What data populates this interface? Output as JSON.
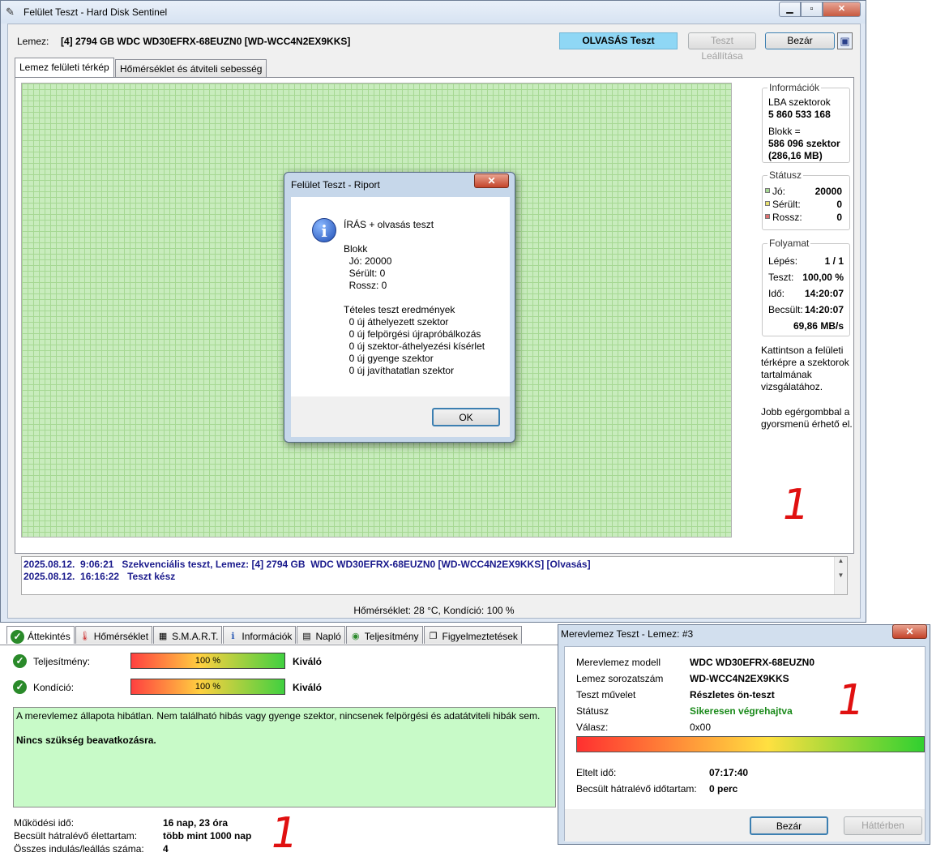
{
  "main_window": {
    "title": "Felület Teszt - Hard Disk Sentinel",
    "disk_label": "Lemez:",
    "disk_value": "[4] 2794 GB  WDC WD30EFRX-68EUZN0 [WD-WCC4N2EX9KKS]",
    "mode_label": "OLVASÁS Teszt",
    "stop_button": "Teszt Leállítása",
    "close_button": "Bezár",
    "tabs": [
      "Lemez felületi térkép",
      "Hőmérséklet és átviteli sebesség"
    ],
    "info": {
      "legend": "Információk",
      "lba_label": "LBA szektorok",
      "lba_value": "5 860 533 168",
      "block_label": "Blokk =",
      "block_value": "586 096 szektor",
      "block_size": "(286,16 MB)"
    },
    "status": {
      "legend": "Státusz",
      "good_label": "Jó:",
      "good_value": "20000",
      "damaged_label": "Sérült:",
      "damaged_value": "0",
      "bad_label": "Rossz:",
      "bad_value": "0",
      "good_color": "#a6d893",
      "damaged_color": "#e8e070",
      "bad_color": "#e07070"
    },
    "progress": {
      "legend": "Folyamat",
      "step_label": "Lépés:",
      "step_value": "1 / 1",
      "test_label": "Teszt:",
      "test_value": "100,00 %",
      "time_label": "Idő:",
      "time_value": "14:20:07",
      "est_label": "Becsült:",
      "est_value": "14:20:07",
      "speed": "69,86 MB/s"
    },
    "hint1": "Kattintson a felületi térképre a szektorok tartalmának vizsgálatához.",
    "hint2": "Jobb egérgombbal a gyorsmenü érhető el.",
    "mark": "1",
    "log": [
      "2025.08.12.  9:06:21   Szekvenciális teszt, Lemez: [4] 2794 GB  WDC WD30EFRX-68EUZN0 [WD-WCC4N2EX9KKS] [Olvasás]",
      "2025.08.12.  16:16:22   Teszt kész"
    ],
    "statusbar": "Hőmérséklet: 28  °C, Kondíció: 100 %"
  },
  "report_dialog": {
    "title": "Felület Teszt - Riport",
    "heading": "ÍRÁS + olvasás teszt",
    "lines": [
      "Blokk",
      "  Jó: 20000",
      "  Sérült: 0",
      "  Rossz: 0",
      "",
      "Tételes teszt eredmények",
      "  0 új áthelyezett szektor",
      "  0 új felpörgési újrapróbálkozás",
      "  0 új szektor-áthelyezési kísérlet",
      "  0 új gyenge szektor",
      "  0 új javíthatatlan szektor"
    ],
    "ok_button": "OK"
  },
  "overview": {
    "tabs": [
      "Áttekintés",
      "Hőmérséklet",
      "S.M.A.R.T.",
      "Információk",
      "Napló",
      "Teljesítmény",
      "Figyelmeztetések"
    ],
    "perf_label": "Teljesítmény:",
    "perf_value": "100 %",
    "perf_rating": "Kiváló",
    "perf_fraction": 1.0,
    "cond_label": "Kondíció:",
    "cond_value": "100 %",
    "cond_rating": "Kiváló",
    "cond_fraction": 1.0,
    "message": "A merevlemez állapota hibátlan. Nem található hibás vagy gyenge szektor, nincsenek felpörgési és adatátviteli hibák sem.",
    "advice": "Nincs szükség beavatkozásra.",
    "uptime_label": "Működési idő:",
    "uptime_value": "16 nap, 23 óra",
    "life_label": "Becsült hátralévő élettartam:",
    "life_value": "több mint 1000 nap",
    "starts_label": "Összes indulás/leállás száma:",
    "starts_value": "4",
    "mark": "1"
  },
  "selftest_dialog": {
    "title": "Merevlemez Teszt - Lemez: #3",
    "model_label": "Merevlemez modell",
    "model_value": "WDC WD30EFRX-68EUZN0",
    "serial_label": "Lemez sorozatszám",
    "serial_value": "WD-WCC4N2EX9KKS",
    "op_label": "Teszt művelet",
    "op_value": "Részletes ön-teszt",
    "status_label": "Státusz",
    "status_value": "Sikeresen végrehajtva",
    "reply_label": "Válasz:",
    "reply_value": "0x00",
    "progress_fraction": 1.0,
    "elapsed_label": "Eltelt idő:",
    "elapsed_value": "07:17:40",
    "remaining_label": "Becsült hátralévő időtartam:",
    "remaining_value": "0 perc",
    "close_button": "Bezár",
    "background_button": "Háttérben",
    "mark": "1",
    "status_color": "#1a8a1a"
  }
}
